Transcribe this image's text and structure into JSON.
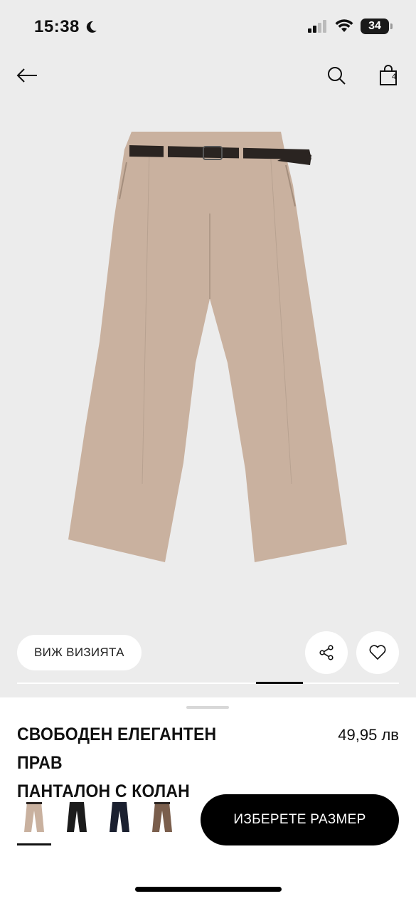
{
  "status_bar": {
    "time": "15:38",
    "battery": "34"
  },
  "header": {
    "back_icon": "arrow-left-icon",
    "search_icon": "search-icon",
    "bag_icon": "shopping-bag-icon",
    "bag_count": "4"
  },
  "gallery": {
    "visit_label": "ВИЖ ВИЗИЯТА",
    "share_icon": "share-icon",
    "favorite_icon": "heart-icon",
    "active_page_fraction_start": 0.627,
    "active_page_fraction_width": 0.123
  },
  "product": {
    "title_line1": "СВОБОДЕН ЕЛЕГАНТЕН ПРАВ",
    "title_line2": "ПАНТАЛОН С КОЛАН",
    "price": "49,95 лв"
  },
  "colors": {
    "hero_bg": "#ececec",
    "beige": "#c9b19f",
    "black": "#1c1c1c",
    "navy": "#1b2030",
    "brown": "#7a5e4c"
  },
  "swatches": [
    {
      "name": "beige",
      "color": "#c9b19f",
      "selected": true
    },
    {
      "name": "black",
      "color": "#1c1c1c",
      "selected": false
    },
    {
      "name": "navy",
      "color": "#1b2030",
      "selected": false
    },
    {
      "name": "brown",
      "color": "#7a5e4c",
      "selected": false
    }
  ],
  "actions": {
    "select_size_label": "ИЗБЕРЕТЕ РАЗМЕР"
  }
}
